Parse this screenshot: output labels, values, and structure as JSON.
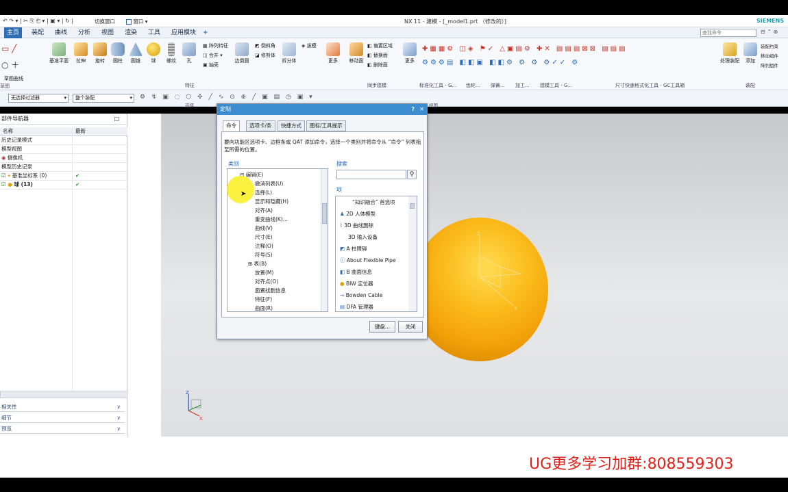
{
  "window": {
    "title": "NX 11 - 建模 - [_model1.prt （修改的）]",
    "brand": "SIEMENS",
    "qat_switch_window": "切换窗口",
    "qat_window": "窗口"
  },
  "search": {
    "placeholder": "查找命令"
  },
  "ribbon_tabs": [
    "主页",
    "装配",
    "曲线",
    "分析",
    "视图",
    "渲染",
    "工具",
    "应用模块"
  ],
  "ribbon": {
    "sketch_curve_label": "草图曲线",
    "sketch_label": "草图",
    "feature_group_label": "特征",
    "sync_group_label": "同步建模",
    "standard_tools_label": "标准化工具 - G...",
    "gear_label": "齿轮...",
    "spring_label": "弹簧...",
    "machining_label": "加工...",
    "modeling_tools_label": "建模工具 - G...",
    "dim_tools_label": "尺寸快速格式化工具 - GC工具箱",
    "assembly_label": "装配",
    "buttons": [
      {
        "label": "基准平面"
      },
      {
        "label": "拉伸"
      },
      {
        "label": "旋转"
      },
      {
        "label": "圆柱"
      },
      {
        "label": "圆锥"
      },
      {
        "label": "球"
      },
      {
        "label": "螺纹"
      },
      {
        "label": "孔"
      }
    ],
    "small_feature": [
      "阵列特征",
      "合并",
      "抽壳"
    ],
    "edge_blend": "边倒圆",
    "chamfer": [
      "倒斜角",
      "修剪体"
    ],
    "split_body": "拆分体",
    "draft": "拔模",
    "more": "更多",
    "move_face": "移动面",
    "sync_small": [
      "偏置区域",
      "替换面",
      "删除面"
    ],
    "more2": "更多",
    "handle_assembly": "处理装配",
    "add": "添加",
    "assembly_small": [
      "装配约束",
      "移动组件",
      "阵列组件"
    ]
  },
  "toolbar2": {
    "filter": "无选择过滤器",
    "scope": "整个装配",
    "selection_label": "选择",
    "view_label": "视图"
  },
  "navigator": {
    "title": "部件导航器",
    "col_name": "名称",
    "col_latest": "最新",
    "rows": [
      {
        "label": "历史记录模式",
        "check": false
      },
      {
        "label": "模型视图",
        "check": false
      },
      {
        "label": "摄像机",
        "check": false
      },
      {
        "label": "模型历史记录",
        "check": false
      },
      {
        "label": "基准坐标系 (0)",
        "check": true
      },
      {
        "label": "球 (13)",
        "check": true
      }
    ],
    "footer": [
      "相关性",
      "细节",
      "预览"
    ]
  },
  "dialog": {
    "title": "定制",
    "tabs": [
      "命令",
      "选项卡/条",
      "快捷方式",
      "图标/工具提示"
    ],
    "instruction": "要向功能区选项卡、边框条或 QAT 添加命令，选择一个类别并将命令从 “命令” 列表拖至所需的位置。",
    "category_label": "类别",
    "search_label": "搜索",
    "items_label": "项",
    "categories": [
      "编辑(E)",
      "撤消列表(U)",
      "选择(L)",
      "显示和隐藏(H)",
      "对齐(A)",
      "重变曲线(K)...",
      "曲线(V)",
      "尺寸(E)",
      "注释(O)",
      "符号(S)",
      "表(B)",
      "放置(M)",
      "对齐点(O)",
      "面置找删信息",
      "特征(F)",
      "曲面(R)"
    ],
    "items": [
      "“知识融合” 首选项",
      "2D 人体模型",
      "3D 曲线删除",
      "3D 输入设备",
      "A 柱障碍",
      "About Flexible Pipe",
      "B 曲面信息",
      "BIW 定位器",
      "Bowden Cable",
      "DFA 管理器"
    ],
    "keyboard_button": "键盘...",
    "close_button": "关闭"
  },
  "watermark": "UG更多学习加群:808559303"
}
